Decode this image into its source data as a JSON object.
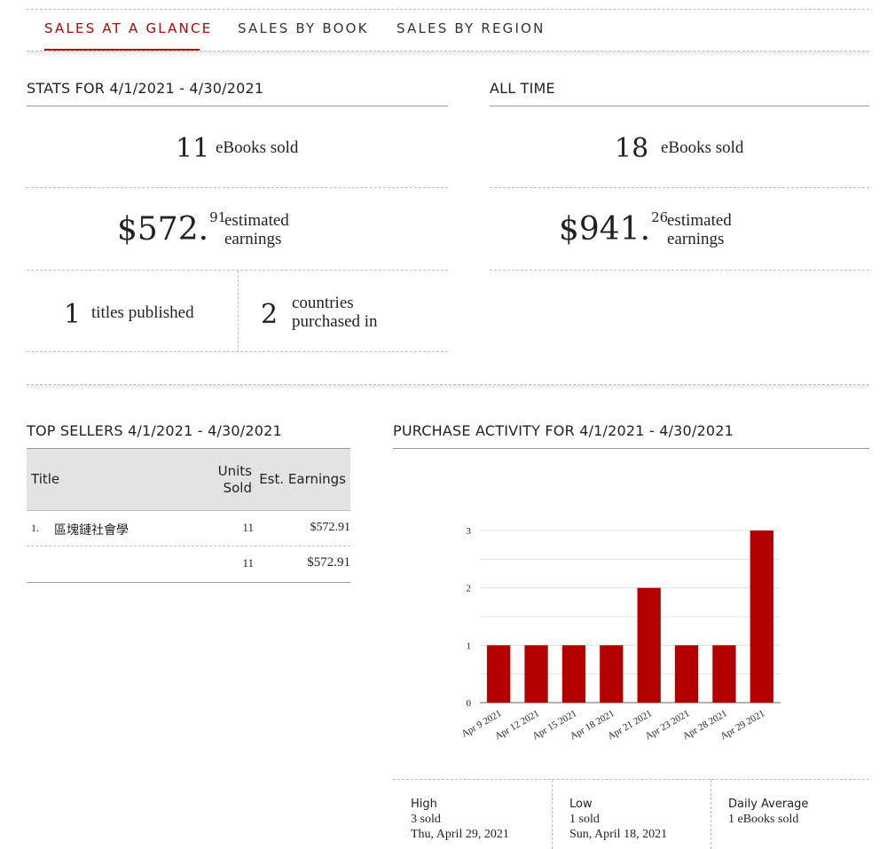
{
  "tabs": [
    {
      "label": "SALES AT A GLANCE",
      "active": true
    },
    {
      "label": "SALES BY BOOK",
      "active": false
    },
    {
      "label": "SALES BY REGION",
      "active": false
    }
  ],
  "period_stats": {
    "title": "STATS FOR 4/1/2021 - 4/30/2021",
    "ebooks_sold": {
      "value": "11",
      "label": "eBooks sold"
    },
    "earnings": {
      "dollars": "$572.",
      "cents": "91",
      "label_line1": "estimated",
      "label_line2": "earnings"
    },
    "titles_published": {
      "value": "1",
      "label": "titles published"
    },
    "countries": {
      "value": "2",
      "label_line1": "countries",
      "label_line2": "purchased in"
    }
  },
  "all_time": {
    "title": "ALL TIME",
    "ebooks_sold": {
      "value": "18",
      "label": "eBooks sold"
    },
    "earnings": {
      "dollars": "$941.",
      "cents": "26",
      "label_line1": "estimated",
      "label_line2": "earnings"
    }
  },
  "top_sellers": {
    "title": "TOP SELLERS 4/1/2021 - 4/30/2021",
    "headers": {
      "title": "Title",
      "units_line1": "Units",
      "units_line2": "Sold",
      "earnings": "Est. Earnings"
    },
    "rows": [
      {
        "rank": "1.",
        "title": "區塊鏈社會學",
        "units": "11",
        "earnings": "$572.91"
      }
    ],
    "totals": {
      "units": "11",
      "earnings": "$572.91"
    }
  },
  "purchase_activity": {
    "title": "PURCHASE ACTIVITY FOR 4/1/2021 - 4/30/2021",
    "high": {
      "title": "High",
      "line1": "3 sold",
      "line2": "Thu, April 29, 2021"
    },
    "low": {
      "title": "Low",
      "line1": "1 sold",
      "line2": "Sun, April 18, 2021"
    },
    "daily_average": {
      "title": "Daily Average",
      "line1": "1 eBooks sold"
    }
  },
  "chart_data": {
    "type": "bar",
    "title": "",
    "xlabel": "",
    "ylabel": "",
    "categories": [
      "Apr 9 2021",
      "Apr 12 2021",
      "Apr 15 2021",
      "Apr 18 2021",
      "Apr 21 2021",
      "Apr 23 2021",
      "Apr 28 2021",
      "Apr 29 2021"
    ],
    "values": [
      1,
      1,
      1,
      1,
      2,
      1,
      1,
      3
    ],
    "ylim": [
      0,
      3
    ],
    "yticks": [
      "0",
      "1",
      "2",
      "3"
    ],
    "grid": true,
    "bar_color": "#b50000"
  },
  "colors": {
    "accent": "#b50000"
  }
}
